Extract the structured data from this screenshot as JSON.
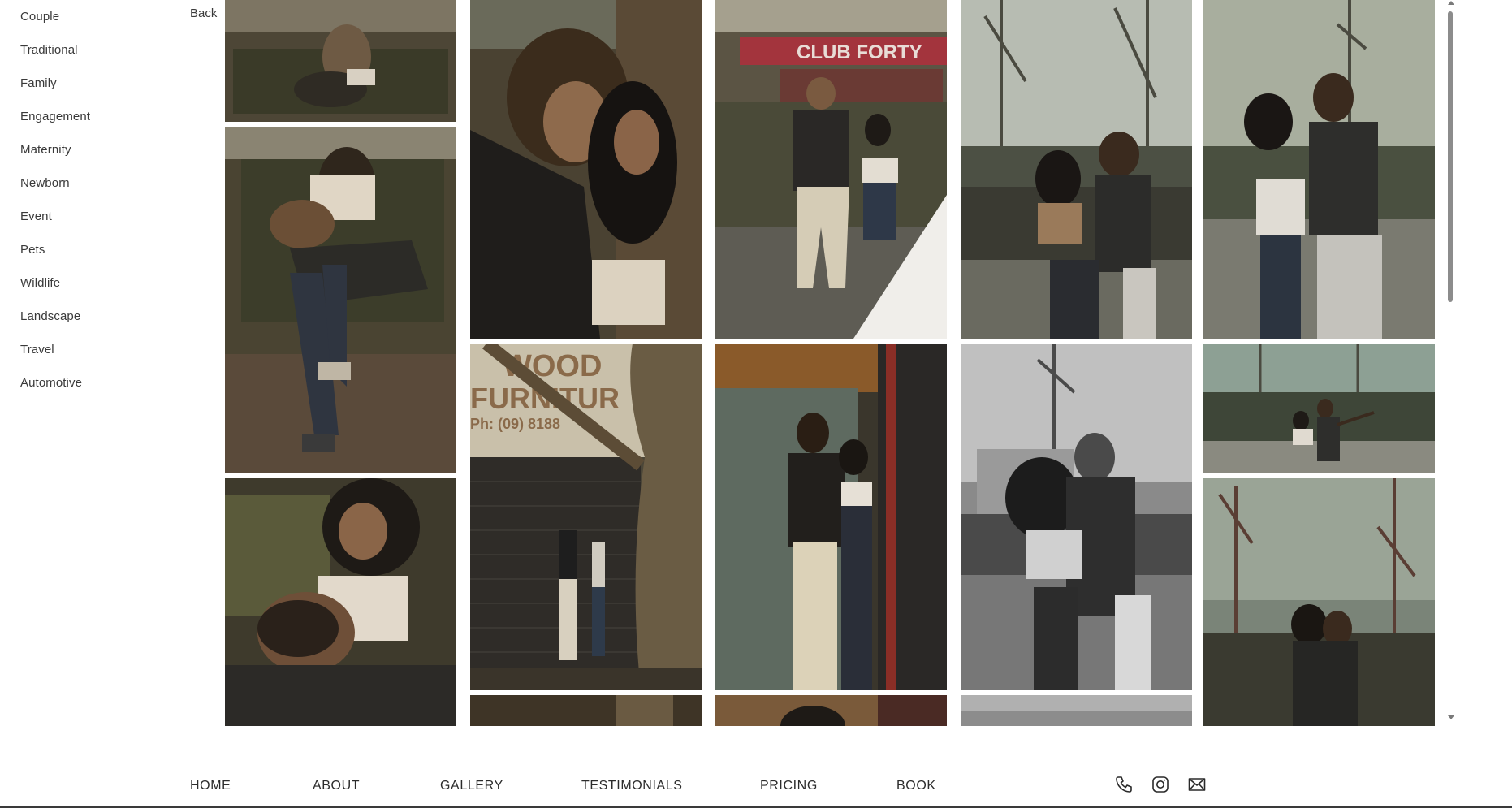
{
  "sidebar": {
    "categories": [
      {
        "label": "Couple"
      },
      {
        "label": "Traditional"
      },
      {
        "label": "Family"
      },
      {
        "label": "Engagement"
      },
      {
        "label": "Maternity"
      },
      {
        "label": "Newborn"
      },
      {
        "label": "Event"
      },
      {
        "label": "Pets"
      },
      {
        "label": "Wildlife"
      },
      {
        "label": "Landscape"
      },
      {
        "label": "Travel"
      },
      {
        "label": "Automotive"
      }
    ],
    "back_label": "Back"
  },
  "gallery": {
    "photos": [
      {
        "subject": "couple on park bench, woman cradling man's head"
      },
      {
        "subject": "couple on bench, man lying across woman's lap"
      },
      {
        "subject": "woman laughing with man on her lap"
      },
      {
        "subject": "couple kissing against a tree"
      },
      {
        "subject": "couple by tree in front of shuttered furniture store",
        "sign_text": "WOOD FURNITUR Ph: (09) 8188"
      },
      {
        "subject": "couple walking on street outside club",
        "sign_text": "CLUB FORTY"
      },
      {
        "subject": "couple embracing in doorway"
      },
      {
        "subject": "couple at wall with cranes behind"
      },
      {
        "subject": "black-and-white couple embracing, cranes behind"
      },
      {
        "subject": "couple posing, cranes behind"
      },
      {
        "subject": "couple pointing toward skyline"
      },
      {
        "subject": "woman hugging man, cranes behind"
      }
    ]
  },
  "footer": {
    "nav": [
      {
        "label": "HOME"
      },
      {
        "label": "ABOUT"
      },
      {
        "label": "GALLERY"
      },
      {
        "label": "TESTIMONIALS"
      },
      {
        "label": "PRICING"
      },
      {
        "label": "BOOK"
      }
    ],
    "icons": [
      "phone-icon",
      "instagram-icon",
      "mail-icon"
    ]
  },
  "colors": {
    "text": "#3a3a3a",
    "scrollbar_thumb": "#8c8c8c",
    "photo_tone_warm": "#5a4a32",
    "photo_tone_sky": "#9ba596"
  }
}
